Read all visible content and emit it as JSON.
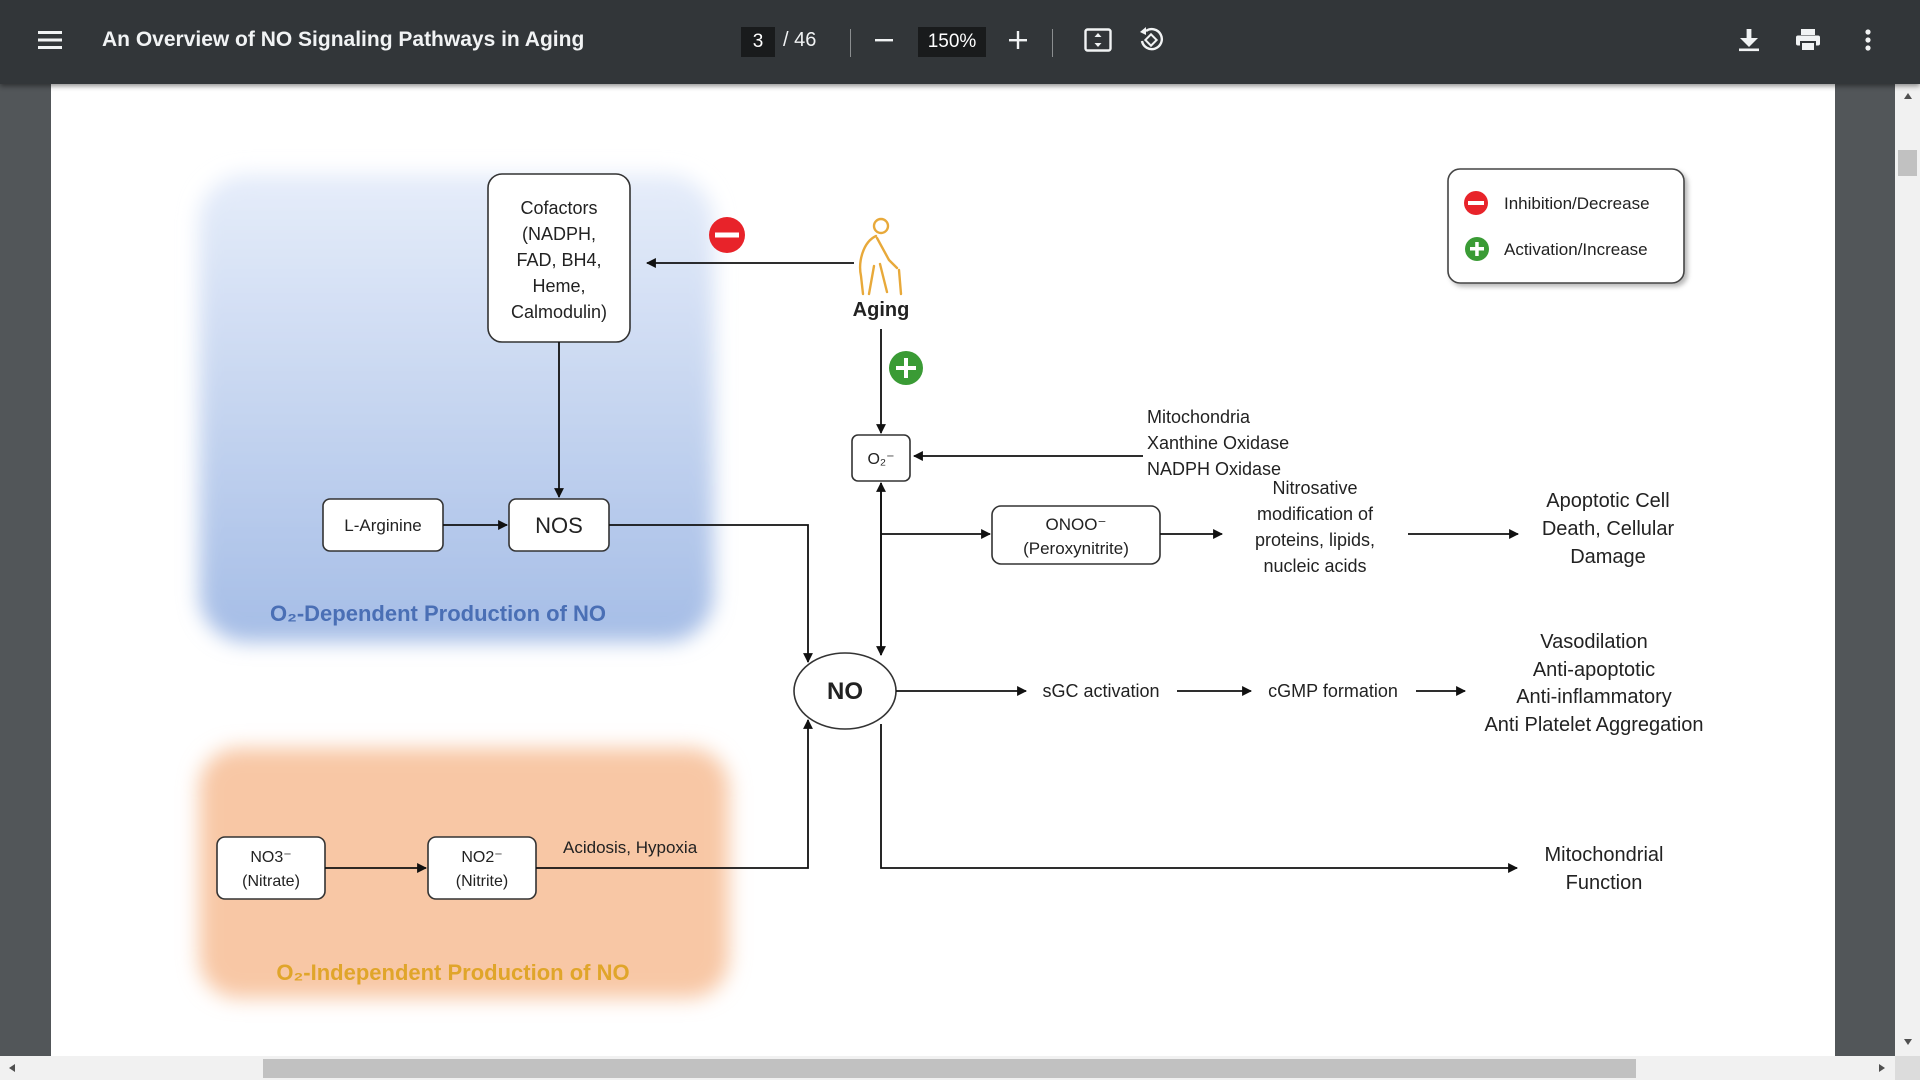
{
  "toolbar": {
    "title": "An Overview of NO Signaling Pathways in Aging",
    "current_page": "3",
    "page_total": "/ 46",
    "zoom": "150%",
    "icons": [
      "menu-icon",
      "zoom-out-icon",
      "zoom-in-icon",
      "fit-page-icon",
      "rotate-icon",
      "download-icon",
      "print-icon",
      "more-vert-icon"
    ]
  },
  "diagram": {
    "legend": {
      "inhibition": "Inhibition/Decrease",
      "activation": "Activation/Increase"
    },
    "cofactors": [
      "Cofactors",
      "(NADPH,",
      "FAD, BH4,",
      "Heme,",
      "Calmodulin)"
    ],
    "aging": "Aging",
    "l_arginine": "L-Arginine",
    "nos": "NOS",
    "o2_dependent": "O₂-Dependent Production of NO",
    "o2_independent": "O₂-Independent Production of NO",
    "superoxide": "O₂⁻",
    "sources": [
      "Mitochondria",
      "Xanthine Oxidase",
      "NADPH Oxidase"
    ],
    "onoo": [
      "ONOO⁻",
      "(Peroxynitrite)"
    ],
    "nitrosative": [
      "Nitrosative",
      "modification of",
      "proteins, lipids,",
      "nucleic acids"
    ],
    "apoptotic": [
      "Apoptotic Cell",
      "Death, Cellular",
      "Damage"
    ],
    "no": "NO",
    "sgc": "sGC activation",
    "cgmp": "cGMP formation",
    "effects": [
      "Vasodilation",
      "Anti-apoptotic",
      "Anti-inflammatory",
      "Anti Platelet Aggregation"
    ],
    "mito_function": [
      "Mitochondrial",
      "Function"
    ],
    "nitrate": [
      "NO3⁻",
      "(Nitrate)"
    ],
    "nitrite": [
      "NO2⁻",
      "(Nitrite)"
    ],
    "acidosis": "Acidosis, Hypoxia"
  },
  "colors": {
    "toolbar_bg": "#323639",
    "viewer_bg": "#525659",
    "inhibit_red": "#e8232a",
    "activate_green": "#3a9b35",
    "blue_region": "#a9c0e8",
    "orange_region": "#f7c09a",
    "blue_label": "#4a6fb5",
    "orange_label": "#e0a52a"
  }
}
